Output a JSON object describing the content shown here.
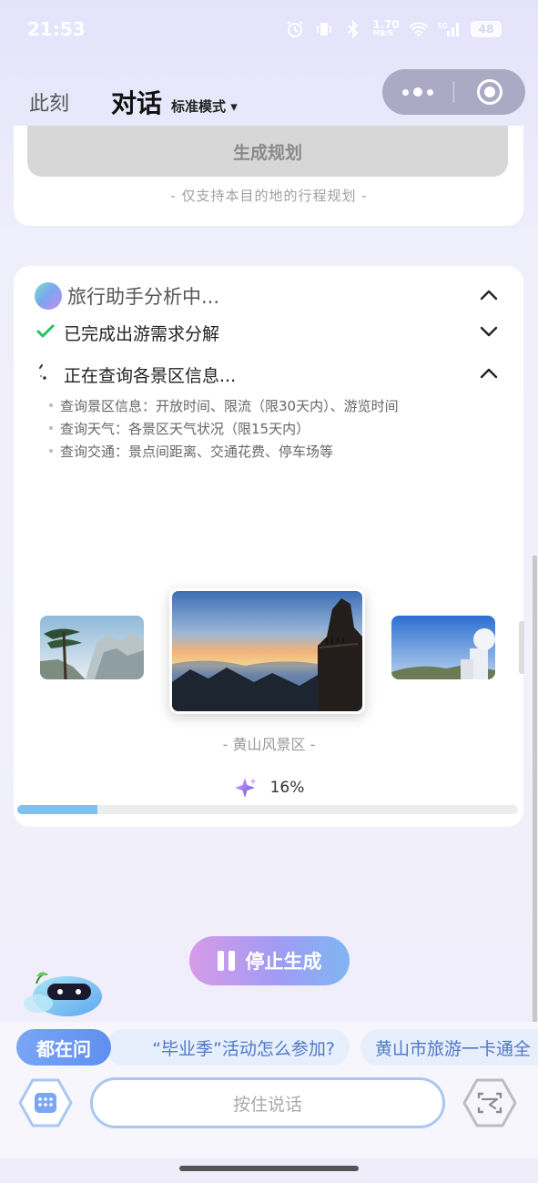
{
  "status_bar": {
    "time": "21:53",
    "network_speed": "1.70",
    "network_unit": "MB/S",
    "signal_label": "5G",
    "battery": "48"
  },
  "header": {
    "tab_now": "此刻",
    "tab_chat": "对话",
    "mode": "标准模式 ▾"
  },
  "plan_card": {
    "button": "生成规划",
    "note": "- 仅支持本目的地的行程规划 -"
  },
  "analysis": {
    "title": "旅行助手分析中...",
    "step_done": "已完成出游需求分解",
    "step_active": "正在查询各景区信息...",
    "details": [
      "查询景区信息：开放时间、限流（限30天内）、游览时间",
      "查询天气：各景区天气状况（限15天内）",
      "查询交通：景点间距离、交通花费、停车场等"
    ]
  },
  "carousel": {
    "current_name": "- 黄山风景区 -"
  },
  "progress": {
    "percent_label": "16%",
    "fraction": 0.16
  },
  "actions": {
    "stop": "停止生成"
  },
  "suggestions": {
    "badge": "都在问",
    "chips": [
      "“毕业季”活动怎么参加?",
      "黄山市旅游一卡通全"
    ]
  },
  "input": {
    "voice_placeholder": "按住说话"
  },
  "colors": {
    "accent_blue": "#7fc0ef",
    "check_green": "#22c55e",
    "chip_text": "#4d78c9"
  },
  "icons": [
    "alarm-icon",
    "vibrate-icon",
    "bluetooth-icon",
    "wifi-icon",
    "signal-icon",
    "battery-icon",
    "more-dots-icon",
    "target-icon",
    "chevron-up-icon",
    "chevron-down-icon",
    "check-icon",
    "spinner-icon",
    "sparkle-icon",
    "pause-icon",
    "keyboard-icon",
    "scan-icon"
  ]
}
